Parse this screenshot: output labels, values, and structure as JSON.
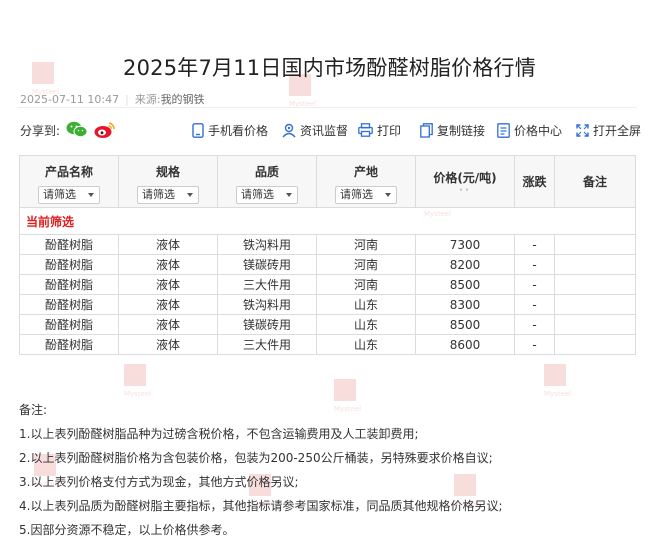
{
  "title": "2025年7月11日国内市场酚醛树脂价格行情",
  "meta": {
    "datetime": "2025-07-11 10:47",
    "source_label": "来源:",
    "source": "我的钢铁"
  },
  "share": {
    "label": "分享到:"
  },
  "toolbar": [
    {
      "label": "手机看价格",
      "icon": "mobile-icon"
    },
    {
      "label": "资讯监督",
      "icon": "supervise-icon"
    },
    {
      "label": "打印",
      "icon": "print-icon"
    },
    {
      "label": "复制链接",
      "icon": "link-icon"
    },
    {
      "label": "价格中心",
      "icon": "price-center-icon"
    },
    {
      "label": "打开全屏",
      "icon": "fullscreen-icon"
    }
  ],
  "table": {
    "headers": [
      "产品名称",
      "规格",
      "品质",
      "产地",
      "价格(元/吨)",
      "涨跌",
      "备注"
    ],
    "filter_label": "请筛选",
    "current_filter_label": "当前筛选",
    "rows": [
      [
        "酚醛树脂",
        "液体",
        "铁沟料用",
        "河南",
        "7300",
        "-",
        ""
      ],
      [
        "酚醛树脂",
        "液体",
        "镁碳砖用",
        "河南",
        "8200",
        "-",
        ""
      ],
      [
        "酚醛树脂",
        "液体",
        "三大件用",
        "河南",
        "8500",
        "-",
        ""
      ],
      [
        "酚醛树脂",
        "液体",
        "铁沟料用",
        "山东",
        "8300",
        "-",
        ""
      ],
      [
        "酚醛树脂",
        "液体",
        "镁碳砖用",
        "山东",
        "8500",
        "-",
        ""
      ],
      [
        "酚醛树脂",
        "液体",
        "三大件用",
        "山东",
        "8600",
        "-",
        ""
      ]
    ]
  },
  "notes": {
    "heading": "备注:",
    "items": [
      "1.以上表列酚醛树脂品种为过磅含税价格，不包含运输费用及人工装卸费用;",
      "2.以上表列酚醛树脂价格为含包装价格，包装为200-250公斤桶装，另特殊要求价格自议;",
      "3.以上表列价格支付方式为现金，其他方式价格另议;",
      "4.以上表列品质为酚醛树脂主要指标，其他指标请参考国家标准，同品质其他规格价格另议;",
      "5.因部分资源不稳定，以上价格供参考。"
    ]
  },
  "colors": {
    "accent_red": "#e02020",
    "wechat_green": "#3cb034",
    "weibo_red": "#e6162d",
    "icon_blue": "#2f6fd6"
  }
}
